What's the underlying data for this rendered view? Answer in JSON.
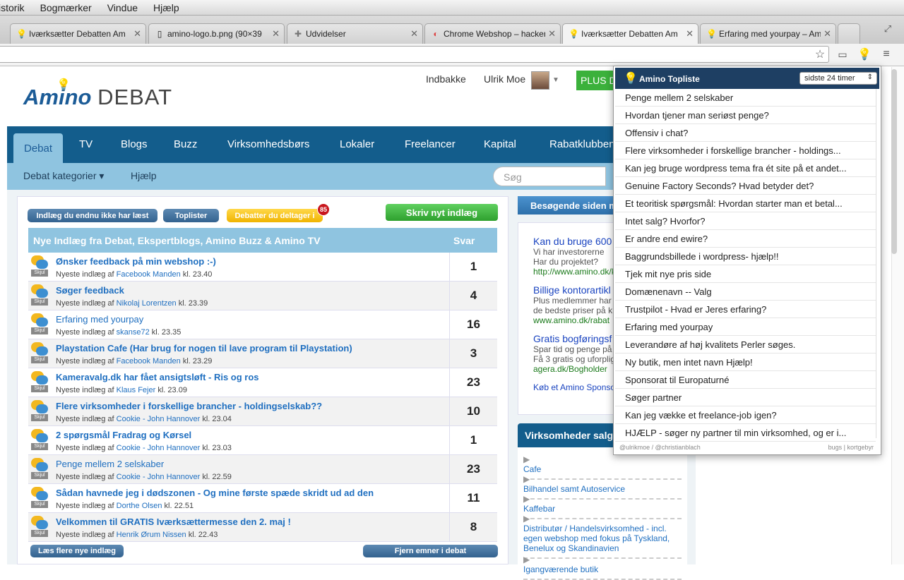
{
  "menubar": {
    "items": [
      "istorik",
      "Bogmærker",
      "Vindue",
      "Hjælp"
    ]
  },
  "tabs": [
    {
      "title": "Iværksætter Debatten Am",
      "icon": "bulb"
    },
    {
      "title": "amino-logo.b.png (90×39",
      "icon": "page"
    },
    {
      "title": "Udvidelser",
      "icon": "puzzle"
    },
    {
      "title": "Chrome Webshop – hacker",
      "icon": "store"
    },
    {
      "title": "Iværksætter Debatten Am",
      "icon": "bulb"
    },
    {
      "title": "Erfaring med yourpay – Am",
      "icon": "bulb"
    }
  ],
  "site": {
    "logo_main": "Amino",
    "logo_sub": "DEBAT",
    "inbox": "Indbakke",
    "user": "Ulrik Moe",
    "plus": "PLUS D",
    "nav": [
      "Debat",
      "TV",
      "Blogs",
      "Buzz",
      "Virksomhedsbørs",
      "Lokaler",
      "Freelancer",
      "Kapital",
      "Rabatklubben"
    ],
    "subnav": {
      "categories": "Debat kategorier ▾",
      "help": "Hjælp"
    },
    "search_placeholder": "Søg"
  },
  "forum": {
    "btn_unread": "Indlæg du endnu ikke har læst",
    "btn_toplist": "Toplister",
    "btn_participating": "Debatter du deltager i",
    "badge": "85",
    "btn_new": "Skriv nyt indlæg",
    "header_title": "Nye Indlæg fra Debat, Ekspertblogs, Amino Buzz & Amino TV",
    "header_replies": "Svar",
    "latest_label": "Nyeste indlæg",
    "by": "af",
    "at": "kl.",
    "hide": "Skjul",
    "rows": [
      {
        "title": "Ønsker feedback på min webshop :-)",
        "user": "Facebook Manden",
        "time": "23.40",
        "count": "1"
      },
      {
        "title": "Søger feedback",
        "user": "Nikolaj Lorentzen",
        "time": "23.39",
        "count": "4"
      },
      {
        "title": "Erfaring med yourpay",
        "user": "skanse72",
        "time": "23.35",
        "count": "16"
      },
      {
        "title": "Playstation Cafe (Har brug for nogen til lave program til Playstation)",
        "user": "Facebook Manden",
        "time": "23.29",
        "count": "3"
      },
      {
        "title": "Kameravalg.dk har fået ansigtsløft - Ris og ros",
        "user": "Klaus Fejer",
        "time": "23.09",
        "count": "23"
      },
      {
        "title": "Flere virksomheder i forskellige brancher - holdingselskab??",
        "user": "Cookie - John Hannover",
        "time": "23.04",
        "count": "10"
      },
      {
        "title": "2 spørgsmål Fradrag og Kørsel",
        "user": "Cookie - John Hannover",
        "time": "23.03",
        "count": "1"
      },
      {
        "title": "Penge mellem 2 selskaber",
        "user": "Cookie - John Hannover",
        "time": "22.59",
        "count": "23"
      },
      {
        "title": "Sådan havnede jeg i dødszonen - Og mine første spæde skridt ud ad den",
        "user": "Dorthe Olsen",
        "time": "22.51",
        "count": "11"
      },
      {
        "title": "Velkommen til GRATIS Iværksættermesse den 2. maj !",
        "user": "Henrik Ørum Nissen",
        "time": "22.43",
        "count": "8"
      }
    ],
    "btn_more": "Læs flere nye indlæg",
    "btn_remove": "Fjern emner i debat"
  },
  "sidebar": {
    "visitors_title": "Besøgende siden m",
    "ads": [
      {
        "title": "Kan du bruge 600",
        "l1": "Vi har investorerne",
        "l2": "Har du projektet?",
        "url": "http://www.amino.dk/k"
      },
      {
        "title": "Billige kontorartikl",
        "l1": "Plus medlemmer har",
        "l2": "de bedste priser på k",
        "url": "www.amino.dk/rabat"
      },
      {
        "title": "Gratis bogføringsf",
        "l1": "Spar tid og penge på",
        "l2": "Få 3 gratis og uforplig",
        "url": "agera.dk/Bogholder"
      }
    ],
    "ad_footer": "Køb et Amino Sponso",
    "companies_title": "Virksomheder salg",
    "companies": [
      "Cafe",
      "Bilhandel samt Autoservice",
      "Kaffebar",
      "Distributør / Handelsvirksomhed - incl. egen webshop med fokus på Tyskland, Benelux og Skandinavien",
      "Igangværende butik"
    ]
  },
  "popup": {
    "title": "Amino Topliste",
    "select": "sidste 24 timer",
    "items": [
      "Penge mellem 2 selskaber",
      "Hvordan tjener man seriøst penge?",
      "Offensiv i chat?",
      "Flere virksomheder i forskellige brancher - holdings...",
      "Kan jeg bruge wordpress tema fra ét site på et andet...",
      "Genuine Factory Seconds? Hvad betyder det?",
      "Et teoritisk spørgsmål: Hvordan starter man et betal...",
      "Intet salg? Hvorfor?",
      "Er andre end ewire?",
      "Baggrundsbillede i wordpress- hjælp!!",
      "Tjek mit nye pris side",
      "Domænenavn -- Valg",
      "Trustpilot - Hvad er Jeres erfaring?",
      "Erfaring med yourpay",
      "Leverandøre af høj kvalitets Perler søges.",
      "Ny butik, men intet navn Hjælp!",
      "Sponsorat til Europaturné",
      "Søger partner",
      "Kan jeg vække et freelance-job igen?",
      "HJÆLP - søger ny partner til min virksomhed, og er i..."
    ],
    "footer_left": "@ulrikmoe / @christianblach",
    "footer_right": "bugs | kortgebyr"
  }
}
